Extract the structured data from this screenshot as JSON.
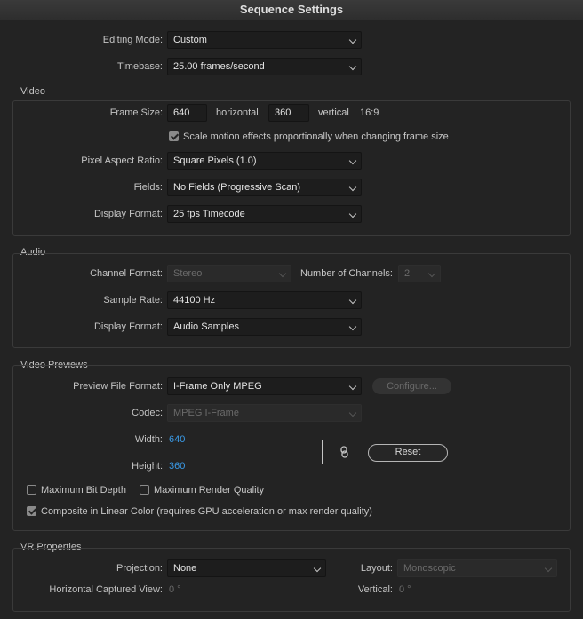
{
  "window": {
    "title": "Sequence Settings"
  },
  "general": {
    "editing_mode_label": "Editing Mode:",
    "editing_mode_value": "Custom",
    "timebase_label": "Timebase:",
    "timebase_value": "25.00  frames/second"
  },
  "video": {
    "title": "Video",
    "frame_size_label": "Frame Size:",
    "frame_width": "640",
    "horizontal_label": "horizontal",
    "frame_height": "360",
    "vertical_label": "vertical",
    "aspect": "16:9",
    "scale_motion_label": "Scale motion effects proportionally when changing frame size",
    "scale_motion_checked": true,
    "pixel_aspect_label": "Pixel Aspect Ratio:",
    "pixel_aspect_value": "Square Pixels (1.0)",
    "fields_label": "Fields:",
    "fields_value": "No Fields (Progressive Scan)",
    "display_format_label": "Display Format:",
    "display_format_value": "25 fps Timecode"
  },
  "audio": {
    "title": "Audio",
    "channel_format_label": "Channel Format:",
    "channel_format_value": "Stereo",
    "num_channels_label": "Number of Channels:",
    "num_channels_value": "2",
    "sample_rate_label": "Sample Rate:",
    "sample_rate_value": "44100 Hz",
    "display_format_label": "Display Format:",
    "display_format_value": "Audio Samples"
  },
  "previews": {
    "title": "Video Previews",
    "preview_format_label": "Preview File Format:",
    "preview_format_value": "I-Frame Only MPEG",
    "configure_label": "Configure...",
    "codec_label": "Codec:",
    "codec_value": "MPEG I-Frame",
    "width_label": "Width:",
    "width_value": "640",
    "height_label": "Height:",
    "height_value": "360",
    "reset_label": "Reset",
    "max_bit_depth_label": "Maximum Bit Depth",
    "max_bit_depth_checked": false,
    "max_render_quality_label": "Maximum Render Quality",
    "max_render_quality_checked": false,
    "linear_color_label": "Composite in Linear Color (requires GPU acceleration or max render quality)",
    "linear_color_checked": true
  },
  "vr": {
    "title": "VR Properties",
    "projection_label": "Projection:",
    "projection_value": "None",
    "layout_label": "Layout:",
    "layout_value": "Monoscopic",
    "h_view_label": "Horizontal Captured View:",
    "h_view_value": "0 °",
    "vertical_label": "Vertical:",
    "vertical_value": "0 °"
  },
  "colors": {
    "accent_blue": "#3a9be8",
    "background": "#232323"
  }
}
